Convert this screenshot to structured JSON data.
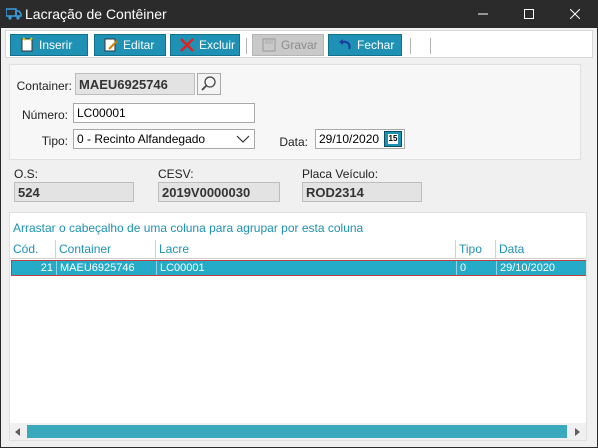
{
  "window": {
    "title": "Lacração de Contêiner"
  },
  "toolbar": {
    "inserir": "Inserir",
    "editar": "Editar",
    "excluir": "Excluir",
    "gravar": "Gravar",
    "fechar": "Fechar"
  },
  "form": {
    "container_label": "Container:",
    "container_value": "MAEU6925746",
    "numero_label": "Número:",
    "numero_value": "LC00001",
    "tipo_label": "Tipo:",
    "tipo_value": "0 - Recinto Alfandegado",
    "data_label": "Data:",
    "data_value": "29/10/2020",
    "calendar_day": "15"
  },
  "info": {
    "os_label": "O.S:",
    "os_value": "524",
    "cesv_label": "CESV:",
    "cesv_value": "2019V0000030",
    "placa_label": "Placa Veículo:",
    "placa_value": "ROD2314"
  },
  "grid": {
    "group_hint": "Arrastar o cabeçalho de uma coluna para agrupar por esta coluna",
    "columns": [
      "Cód.",
      "Container",
      "Lacre",
      "Tipo",
      "Data"
    ],
    "rows": [
      {
        "cod": "21",
        "container": "MAEU6925746",
        "lacre": "LC00001",
        "tipo": "0",
        "data": "29/10/2020"
      }
    ]
  },
  "colors": {
    "accent": "#1e91b4",
    "selected_row": "#25aac7",
    "titlebar": "#2b2b2b"
  }
}
